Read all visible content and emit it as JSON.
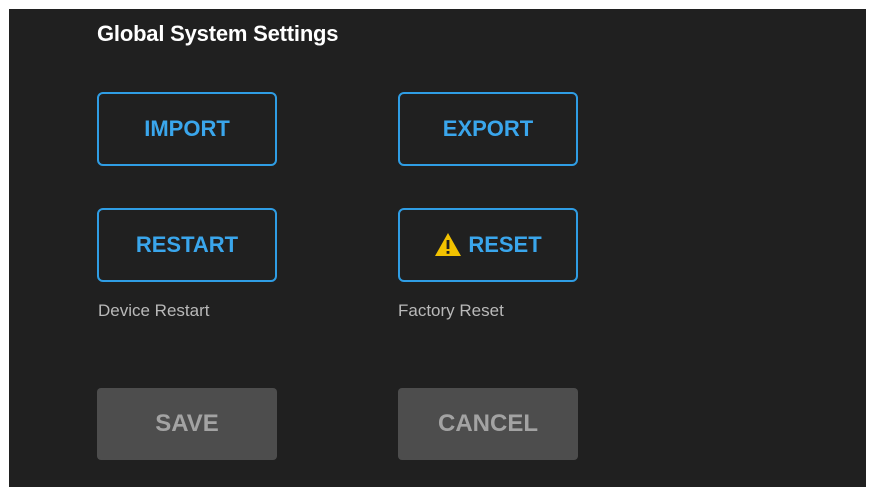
{
  "page": {
    "title": "Global System Settings"
  },
  "buttons": {
    "import_label": "IMPORT",
    "export_label": "EXPORT",
    "restart_label": "RESTART",
    "reset_label": "RESET",
    "save_label": "SAVE",
    "cancel_label": "CANCEL"
  },
  "captions": {
    "restart": "Device Restart",
    "reset": "Factory Reset"
  },
  "icons": {
    "reset_icon": "warning-icon"
  },
  "colors": {
    "background": "#202020",
    "accent": "#2f9de4",
    "warning": "#f2c200",
    "disabled_button": "#4d4d4d",
    "disabled_text": "#a3a3a3"
  }
}
